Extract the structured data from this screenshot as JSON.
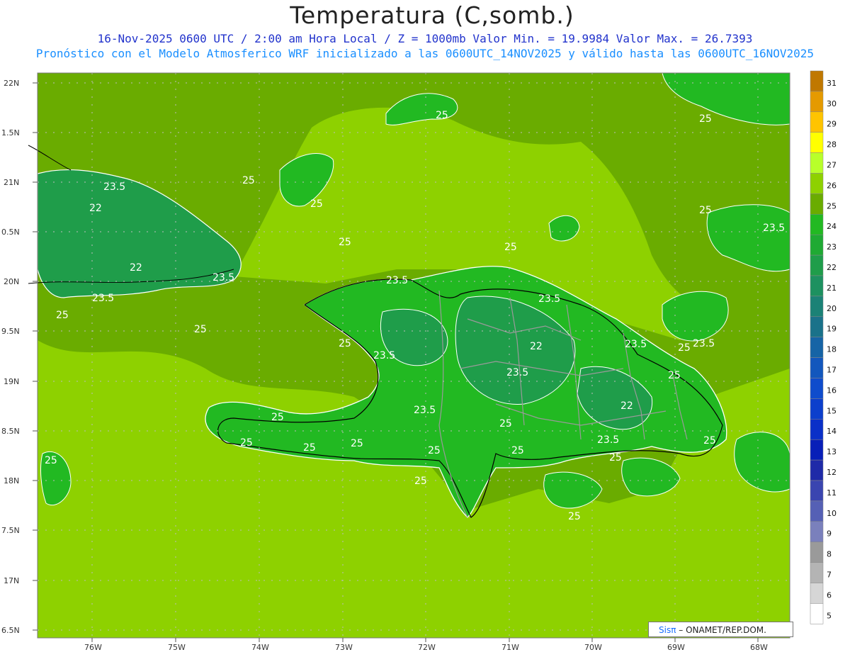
{
  "header": {
    "title": "Temperatura (C,somb.)",
    "subtitle_1": "16-Nov-2025 0600 UTC / 2:00 am Hora Local / Z = 1000mb   Valor Min. = 19.9984  Valor Max. = 26.7393",
    "subtitle_2": "Pronóstico con el Modelo Atmosferico WRF inicializado a las 0600UTC_14NOV2025 y válido hasta las  0600UTC_16NOV2025"
  },
  "map": {
    "lat_labels": [
      "22N",
      "1.5N",
      "21N",
      "0.5N",
      "20N",
      "9.5N",
      "19N",
      "8.5N",
      "18N",
      "7.5N",
      "17N",
      "6.5N"
    ],
    "lon_labels": [
      "76W",
      "75W",
      "74W",
      "73W",
      "72W",
      "71W",
      "70W",
      "69W",
      "68W"
    ],
    "contour_labels": [
      {
        "text": "25"
      },
      {
        "text": "25"
      },
      {
        "text": "25"
      },
      {
        "text": "23.5"
      },
      {
        "text": "22"
      },
      {
        "text": "25"
      },
      {
        "text": "22"
      },
      {
        "text": "23.5"
      },
      {
        "text": "23.5"
      },
      {
        "text": "25"
      },
      {
        "text": "25"
      },
      {
        "text": "25"
      },
      {
        "text": "25"
      },
      {
        "text": "23.5"
      },
      {
        "text": "25"
      },
      {
        "text": "23.5"
      },
      {
        "text": "25"
      },
      {
        "text": "23.5"
      },
      {
        "text": "25"
      },
      {
        "text": "23.5"
      },
      {
        "text": "23.5"
      },
      {
        "text": "22"
      },
      {
        "text": "23.5"
      },
      {
        "text": "25"
      },
      {
        "text": "22"
      },
      {
        "text": "23.5"
      },
      {
        "text": "23.5"
      },
      {
        "text": "25"
      },
      {
        "text": "25"
      },
      {
        "text": "25"
      },
      {
        "text": "25"
      },
      {
        "text": "25"
      },
      {
        "text": "25"
      },
      {
        "text": "23.5"
      },
      {
        "text": "25"
      },
      {
        "text": "25"
      },
      {
        "text": "25"
      },
      {
        "text": "25"
      },
      {
        "text": "25"
      },
      {
        "text": "25"
      }
    ]
  },
  "colorbar": {
    "levels": [
      "31",
      "30",
      "29",
      "28",
      "27",
      "26",
      "25",
      "24",
      "23",
      "22",
      "21",
      "20",
      "19",
      "18",
      "17",
      "16",
      "15",
      "14",
      "13",
      "12",
      "11",
      "10",
      "9",
      "8",
      "7",
      "6",
      "5"
    ],
    "colors": [
      "#c07800",
      "#e59a00",
      "#ffc400",
      "#ffff00",
      "#b8ff2a",
      "#8ed100",
      "#6aac00",
      "#22b922",
      "#1faa33",
      "#1f9d4a",
      "#1d9160",
      "#1b8276",
      "#1a728a",
      "#1664a6",
      "#1257bd",
      "#0f4ccc",
      "#0c3fcc",
      "#0a30c8",
      "#081fb8",
      "#1f2aa8",
      "#3a45b0",
      "#5560b5",
      "#7a80bc",
      "#9a9a9a",
      "#b4b4b4",
      "#d6d6d6",
      "#ffffff"
    ]
  },
  "colors": {
    "ocean_far": "#6aac00",
    "ocean_near": "#8ed100",
    "land": "#22b922",
    "land_cool": "#1f9d4a"
  },
  "credit": {
    "sis": "Sisπ",
    "rest": " – ONAMET/REP.DOM."
  }
}
